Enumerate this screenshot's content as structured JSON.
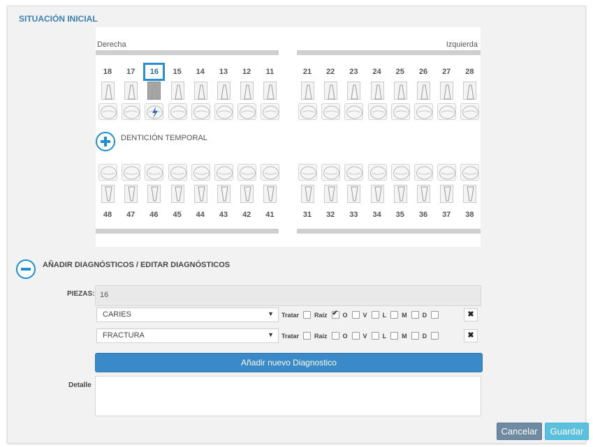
{
  "section_title": "SITUACIÓN INICIAL",
  "odontogram": {
    "right_label": "Derecha",
    "left_label": "Izquierda",
    "upper_right": [
      "18",
      "17",
      "16",
      "15",
      "14",
      "13",
      "12",
      "11"
    ],
    "upper_left": [
      "21",
      "22",
      "23",
      "24",
      "25",
      "26",
      "27",
      "28"
    ],
    "lower_right": [
      "48",
      "47",
      "46",
      "45",
      "44",
      "43",
      "42",
      "41"
    ],
    "lower_left": [
      "31",
      "32",
      "33",
      "34",
      "35",
      "36",
      "37",
      "38"
    ],
    "selected_tooth": "16",
    "temporal_label": "DENTICIÓN TEMPORAL",
    "selected_color": "#2a8fd0"
  },
  "diagnostics": {
    "title": "AÑADIR DIAGNÓSTICOS / EDITAR DIAGNÓSTICOS",
    "piezas_label": "PIEZAS:",
    "piezas_value": "16",
    "rows": [
      {
        "selected": "CARIES",
        "tratar": false,
        "raiz": false,
        "O": true,
        "V": false,
        "L": false,
        "M": false,
        "D": false
      },
      {
        "selected": "FRACTURA",
        "tratar": false,
        "raiz": false,
        "O": false,
        "V": false,
        "L": false,
        "M": false,
        "D": false
      }
    ],
    "tratar_label": "Tratar",
    "raiz_label": "Raíz",
    "surface_labels": [
      "O",
      "V",
      "L",
      "M",
      "D"
    ],
    "delete_icon": "✖",
    "add_button": "Añadir nuevo Diagnostico",
    "detalle_label": "Detalle",
    "detalle_value": ""
  },
  "footer": {
    "cancel": "Cancelar",
    "save": "Guardar"
  }
}
